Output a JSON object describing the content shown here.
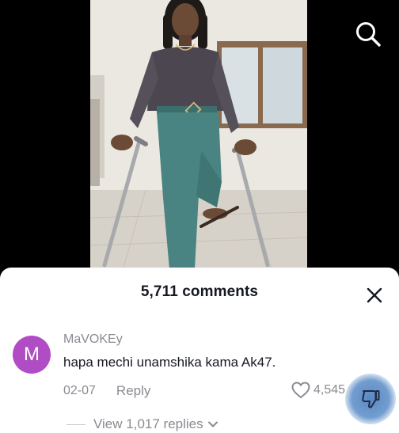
{
  "video": {
    "description_icons": {
      "search": "search-icon"
    }
  },
  "comments_panel": {
    "count_label": "5,711 comments",
    "close_icon": "close-icon"
  },
  "comment": {
    "avatar_initial": "M",
    "avatar_color": "#b04cc4",
    "username": "MaVOKEy",
    "text": "hapa mechi unamshika kama Ak47.",
    "date": "02-07",
    "reply_label": "Reply",
    "like_count": "4,545",
    "like_icon": "heart-outline-icon",
    "dislike_icon": "thumbs-down-icon",
    "view_replies_label": "View 1,017 replies",
    "chevron_icon": "chevron-down-icon"
  },
  "colors": {
    "text_primary": "#161823",
    "text_secondary": "#8a8b91",
    "background": "#000000",
    "sheet": "#ffffff"
  }
}
